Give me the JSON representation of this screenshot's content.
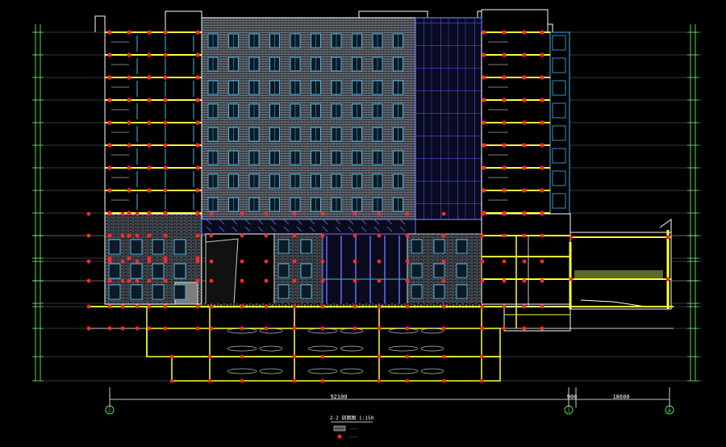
{
  "drawing": {
    "title": "2-2 剖面图 1:150",
    "legend": [
      {
        "swatch": "brick-hatch",
        "label": "————"
      },
      {
        "swatch": "red-dot",
        "label": "————"
      }
    ],
    "dimensions": {
      "main_span": "92100",
      "mid_span": "900",
      "right_span": "18600"
    },
    "grid_axes": {
      "left": "C",
      "middle": "1",
      "right": "B"
    },
    "floor_count": 12,
    "colors": {
      "background": "#000000",
      "brick": "#9aa3ad",
      "window_frame": "#49b6e8",
      "slab": "#ffff33",
      "column_dot": "#ff2a2a",
      "outline": "#ffffff",
      "dimension": "#55dd55",
      "curtain_wall": "#6677ff"
    }
  }
}
